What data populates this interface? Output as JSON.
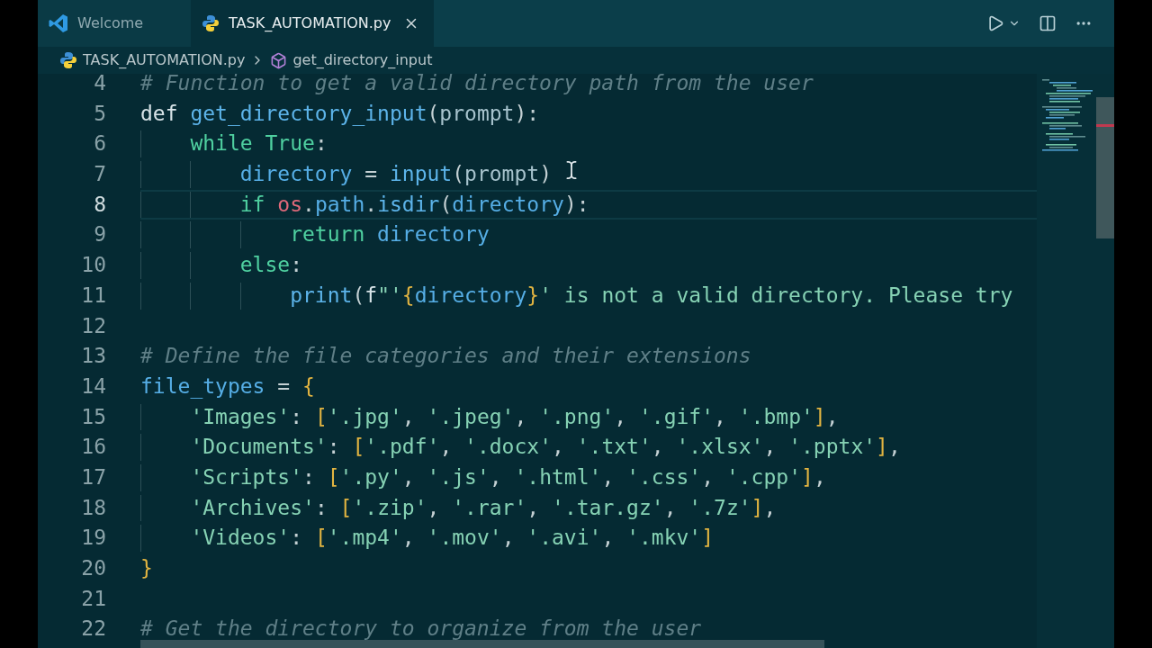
{
  "tabs": [
    {
      "label": "Welcome",
      "kind": "welcome",
      "selected": false
    },
    {
      "label": "TASK_AUTOMATION.py",
      "kind": "python",
      "selected": true
    }
  ],
  "breadcrumb": {
    "file": "TASK_AUTOMATION.py",
    "symbol": "get_directory_input"
  },
  "editor": {
    "lines": [
      {
        "number": "4",
        "current": false,
        "tokens": [
          {
            "kind": "comment",
            "text": "# Function to get a valid directory path from the user"
          }
        ]
      },
      {
        "number": "5",
        "current": false,
        "tokens": [
          {
            "kind": "storage",
            "text": "def "
          },
          {
            "kind": "function",
            "text": "get_directory_input"
          },
          {
            "kind": "plain",
            "text": "("
          },
          {
            "kind": "param",
            "text": "prompt"
          },
          {
            "kind": "plain",
            "text": "):"
          }
        ]
      },
      {
        "number": "6",
        "current": false,
        "tokens": [
          {
            "kind": "keyword",
            "text": "    while True"
          },
          {
            "kind": "plain",
            "text": ":"
          }
        ]
      },
      {
        "number": "7",
        "current": false,
        "tokens": [
          {
            "kind": "variable",
            "text": "        directory"
          },
          {
            "kind": "plain",
            "text": " = "
          },
          {
            "kind": "function",
            "text": "input"
          },
          {
            "kind": "plain",
            "text": "("
          },
          {
            "kind": "param",
            "text": "prompt"
          },
          {
            "kind": "plain",
            "text": ")"
          }
        ]
      },
      {
        "number": "8",
        "current": true,
        "tokens": [
          {
            "kind": "keyword",
            "text": "        if "
          },
          {
            "kind": "module",
            "text": "os"
          },
          {
            "kind": "plain",
            "text": "."
          },
          {
            "kind": "variable",
            "text": "path"
          },
          {
            "kind": "plain",
            "text": "."
          },
          {
            "kind": "function",
            "text": "isdir"
          },
          {
            "kind": "plain",
            "text": "("
          },
          {
            "kind": "variable",
            "text": "directory"
          },
          {
            "kind": "plain",
            "text": "):"
          }
        ]
      },
      {
        "number": "9",
        "current": false,
        "tokens": [
          {
            "kind": "keyword",
            "text": "            return "
          },
          {
            "kind": "variable",
            "text": "directory"
          }
        ]
      },
      {
        "number": "10",
        "current": false,
        "tokens": [
          {
            "kind": "keyword",
            "text": "        else"
          },
          {
            "kind": "plain",
            "text": ":"
          }
        ]
      },
      {
        "number": "11",
        "current": false,
        "tokens": [
          {
            "kind": "function",
            "text": "            print"
          },
          {
            "kind": "plain",
            "text": "("
          },
          {
            "kind": "storage",
            "text": "f"
          },
          {
            "kind": "string",
            "text": "\"'"
          },
          {
            "kind": "bracket",
            "text": "{"
          },
          {
            "kind": "variable",
            "text": "directory"
          },
          {
            "kind": "bracket",
            "text": "}"
          },
          {
            "kind": "string",
            "text": "' is not a valid directory. Please try"
          }
        ]
      },
      {
        "number": "12",
        "current": false
      },
      {
        "number": "13",
        "current": false,
        "tokens": [
          {
            "kind": "comment",
            "text": "# Define the file categories and their extensions"
          }
        ]
      },
      {
        "number": "14",
        "current": false,
        "tokens": [
          {
            "kind": "variable",
            "text": "file_types"
          },
          {
            "kind": "plain",
            "text": " = "
          },
          {
            "kind": "bracket",
            "text": "{"
          }
        ]
      },
      {
        "number": "15",
        "current": false,
        "tokens": [
          {
            "kind": "string",
            "text": "    'Images'"
          },
          {
            "kind": "plain",
            "text": ": "
          },
          {
            "kind": "bracket",
            "text": "["
          },
          {
            "kind": "string",
            "text": "'.jpg'"
          },
          {
            "kind": "plain",
            "text": ", "
          },
          {
            "kind": "string",
            "text": "'.jpeg'"
          },
          {
            "kind": "plain",
            "text": ", "
          },
          {
            "kind": "string",
            "text": "'.png'"
          },
          {
            "kind": "plain",
            "text": ", "
          },
          {
            "kind": "string",
            "text": "'.gif'"
          },
          {
            "kind": "plain",
            "text": ", "
          },
          {
            "kind": "string",
            "text": "'.bmp'"
          },
          {
            "kind": "bracket",
            "text": "]"
          },
          {
            "kind": "plain",
            "text": ","
          }
        ]
      },
      {
        "number": "16",
        "current": false,
        "tokens": [
          {
            "kind": "string",
            "text": "    'Documents'"
          },
          {
            "kind": "plain",
            "text": ": "
          },
          {
            "kind": "bracket",
            "text": "["
          },
          {
            "kind": "string",
            "text": "'.pdf'"
          },
          {
            "kind": "plain",
            "text": ", "
          },
          {
            "kind": "string",
            "text": "'.docx'"
          },
          {
            "kind": "plain",
            "text": ", "
          },
          {
            "kind": "string",
            "text": "'.txt'"
          },
          {
            "kind": "plain",
            "text": ", "
          },
          {
            "kind": "string",
            "text": "'.xlsx'"
          },
          {
            "kind": "plain",
            "text": ", "
          },
          {
            "kind": "string",
            "text": "'.pptx'"
          },
          {
            "kind": "bracket",
            "text": "]"
          },
          {
            "kind": "plain",
            "text": ","
          }
        ]
      },
      {
        "number": "17",
        "current": false,
        "tokens": [
          {
            "kind": "string",
            "text": "    'Scripts'"
          },
          {
            "kind": "plain",
            "text": ": "
          },
          {
            "kind": "bracket",
            "text": "["
          },
          {
            "kind": "string",
            "text": "'.py'"
          },
          {
            "kind": "plain",
            "text": ", "
          },
          {
            "kind": "string",
            "text": "'.js'"
          },
          {
            "kind": "plain",
            "text": ", "
          },
          {
            "kind": "string",
            "text": "'.html'"
          },
          {
            "kind": "plain",
            "text": ", "
          },
          {
            "kind": "string",
            "text": "'.css'"
          },
          {
            "kind": "plain",
            "text": ", "
          },
          {
            "kind": "string",
            "text": "'.cpp'"
          },
          {
            "kind": "bracket",
            "text": "]"
          },
          {
            "kind": "plain",
            "text": ","
          }
        ]
      },
      {
        "number": "18",
        "current": false,
        "tokens": [
          {
            "kind": "string",
            "text": "    'Archives'"
          },
          {
            "kind": "plain",
            "text": ": "
          },
          {
            "kind": "bracket",
            "text": "["
          },
          {
            "kind": "string",
            "text": "'.zip'"
          },
          {
            "kind": "plain",
            "text": ", "
          },
          {
            "kind": "string",
            "text": "'.rar'"
          },
          {
            "kind": "plain",
            "text": ", "
          },
          {
            "kind": "string",
            "text": "'.tar.gz'"
          },
          {
            "kind": "plain",
            "text": ", "
          },
          {
            "kind": "string",
            "text": "'.7z'"
          },
          {
            "kind": "bracket",
            "text": "]"
          },
          {
            "kind": "plain",
            "text": ","
          }
        ]
      },
      {
        "number": "19",
        "current": false,
        "tokens": [
          {
            "kind": "string",
            "text": "    'Videos'"
          },
          {
            "kind": "plain",
            "text": ": "
          },
          {
            "kind": "bracket",
            "text": "["
          },
          {
            "kind": "string",
            "text": "'.mp4'"
          },
          {
            "kind": "plain",
            "text": ", "
          },
          {
            "kind": "string",
            "text": "'.mov'"
          },
          {
            "kind": "plain",
            "text": ", "
          },
          {
            "kind": "string",
            "text": "'.avi'"
          },
          {
            "kind": "plain",
            "text": ", "
          },
          {
            "kind": "string",
            "text": "'.mkv'"
          },
          {
            "kind": "bracket",
            "text": "]"
          }
        ]
      },
      {
        "number": "20",
        "current": false,
        "tokens": [
          {
            "kind": "bracket",
            "text": "}"
          }
        ]
      },
      {
        "number": "21",
        "current": false
      },
      {
        "number": "22",
        "current": false,
        "tokens": [
          {
            "kind": "comment",
            "text": "# Get the directory to organize from the user"
          }
        ]
      }
    ]
  }
}
